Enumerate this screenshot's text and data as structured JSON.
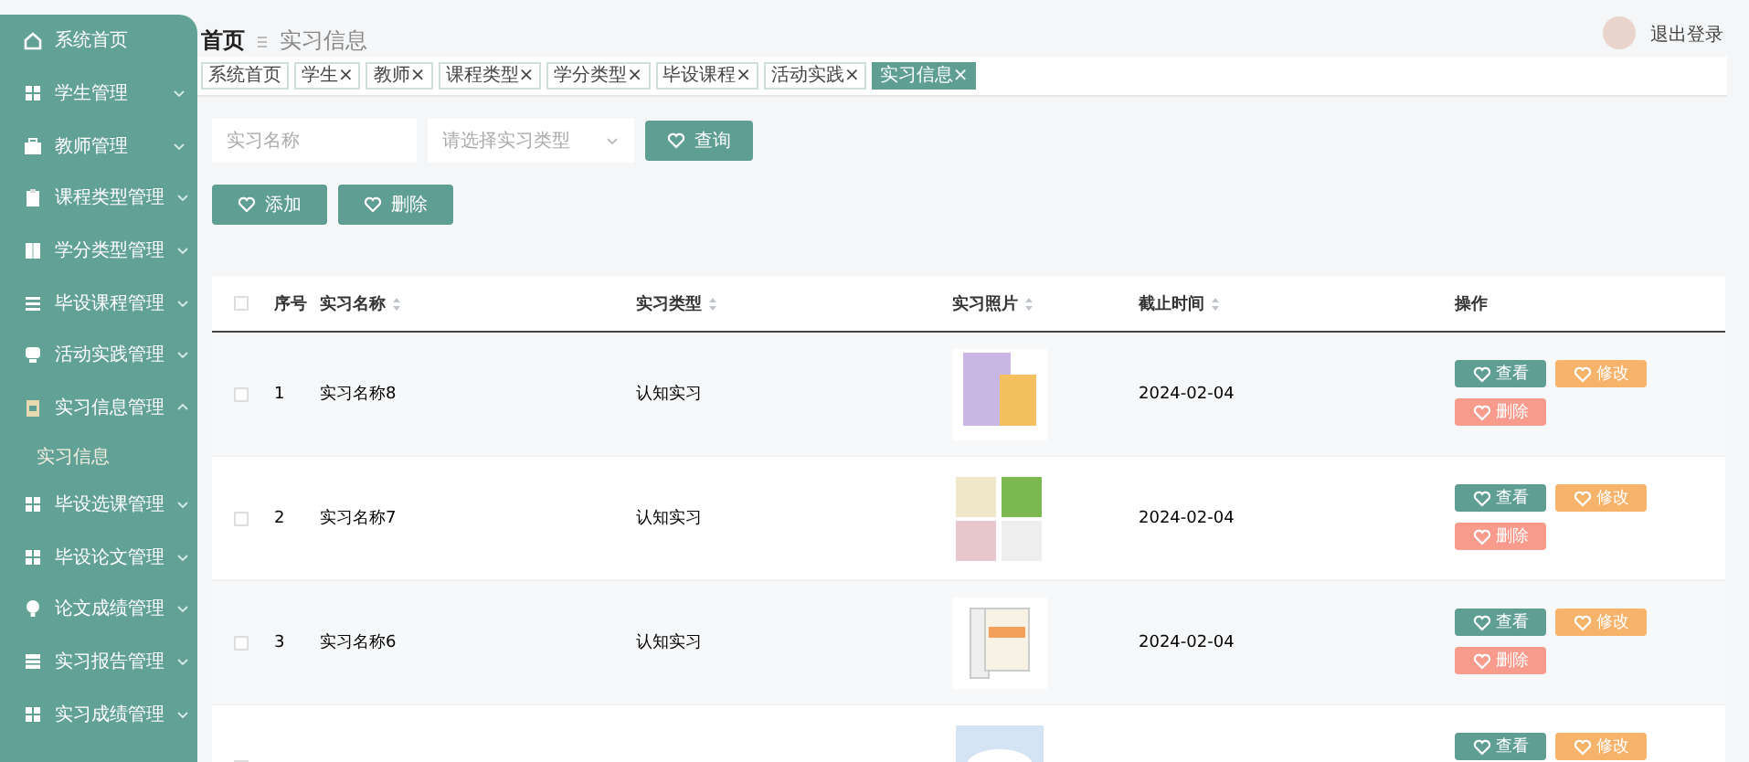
{
  "sidebar": {
    "items": [
      {
        "label": "系统首页"
      },
      {
        "label": "学生管理",
        "expanded": false
      },
      {
        "label": "教师管理",
        "expanded": false
      },
      {
        "label": "课程类型管理",
        "expanded": false
      },
      {
        "label": "学分类型管理",
        "expanded": false
      },
      {
        "label": "毕设课程管理",
        "expanded": false
      },
      {
        "label": "活动实践管理",
        "expanded": false
      },
      {
        "label": "实习信息管理",
        "expanded": true,
        "children": [
          {
            "label": "实习信息"
          }
        ]
      },
      {
        "label": "毕设选课管理",
        "expanded": false
      },
      {
        "label": "毕设论文管理",
        "expanded": false
      },
      {
        "label": "论文成绩管理",
        "expanded": false
      },
      {
        "label": "实习报告管理",
        "expanded": false
      },
      {
        "label": "实习成绩管理",
        "expanded": false
      }
    ]
  },
  "header": {
    "breadcrumb": [
      "首页",
      "实习信息"
    ],
    "logout": "退出登录"
  },
  "tabs": [
    {
      "label": "系统首页",
      "selected": false
    },
    {
      "label": "学生",
      "close": "×",
      "selected": false
    },
    {
      "label": "教师",
      "close": "×",
      "selected": false
    },
    {
      "label": "课程类型",
      "close": "×",
      "selected": false
    },
    {
      "label": "学分类型",
      "close": "×",
      "selected": false
    },
    {
      "label": "毕设课程",
      "close": "×",
      "selected": false
    },
    {
      "label": "活动实践",
      "close": "×",
      "selected": false
    },
    {
      "label": "实习信息",
      "close": "×",
      "selected": true
    }
  ],
  "search": {
    "name_placeholder": "实习名称",
    "type_placeholder": "请选择实习类型",
    "button": "查询"
  },
  "toolbar": [
    "添加",
    "删除"
  ],
  "table": {
    "select_all": {
      "checked": false
    },
    "columns": [
      {
        "label": "序号",
        "sortable": false
      },
      {
        "label": "实习名称",
        "sortable": true
      },
      {
        "label": "实习类型",
        "sortable": true
      },
      {
        "label": "实习照片",
        "sortable": true
      },
      {
        "label": "截止时间",
        "sortable": true
      },
      {
        "label": "操作",
        "sortable": false
      }
    ],
    "rows": [
      {
        "checked": false,
        "index": "1",
        "name": "实习名称8",
        "type": "认知实习",
        "deadline": "2024-02-04",
        "actions": [
          {
            "kind": "view",
            "label": "查看"
          },
          {
            "kind": "edit",
            "label": "修改"
          },
          {
            "kind": "delete",
            "label": "删除"
          }
        ]
      },
      {
        "checked": false,
        "index": "2",
        "name": "实习名称7",
        "type": "认知实习",
        "deadline": "2024-02-04",
        "actions": [
          {
            "kind": "view",
            "label": "查看"
          },
          {
            "kind": "edit",
            "label": "修改"
          },
          {
            "kind": "delete",
            "label": "删除"
          }
        ]
      },
      {
        "checked": false,
        "index": "3",
        "name": "实习名称6",
        "type": "认知实习",
        "deadline": "2024-02-04",
        "actions": [
          {
            "kind": "view",
            "label": "查看"
          },
          {
            "kind": "edit",
            "label": "修改"
          },
          {
            "kind": "delete",
            "label": "删除"
          }
        ]
      },
      {
        "checked": false,
        "actions": [
          {
            "kind": "view",
            "label": "查看"
          },
          {
            "kind": "edit",
            "label": "修改"
          }
        ]
      }
    ]
  }
}
